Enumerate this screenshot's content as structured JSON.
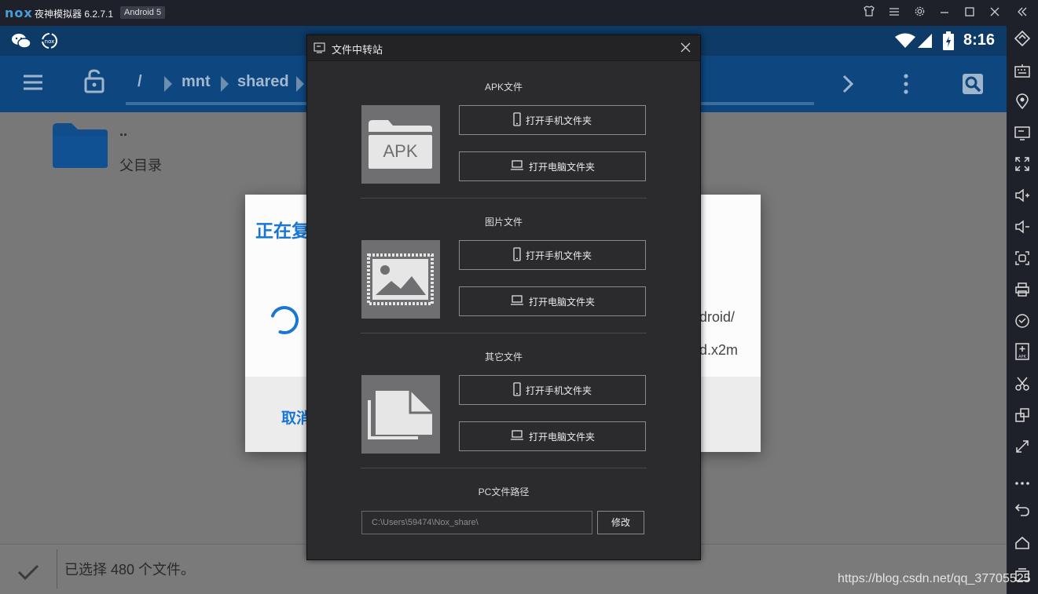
{
  "emulator": {
    "logo": "nox",
    "title": "夜神模拟器 6.2.7.1",
    "android_badge": "Android 5",
    "window_controls": [
      "shirt-icon",
      "menu-icon",
      "gear-icon",
      "minimize-icon",
      "maximize-icon",
      "close-icon",
      "collapse-icon"
    ],
    "toolbar_icons": [
      "rotate-icon",
      "keyboard-icon",
      "location-icon",
      "screen-icon",
      "fullscreen-icon",
      "volume-up-icon",
      "volume-down-icon",
      "screenshot-icon",
      "printer-icon",
      "sync-icon",
      "apk-install-icon",
      "scissors-icon",
      "multi-window-icon",
      "resize-icon",
      "more-icon",
      "back-icon",
      "home-icon",
      "recent-icon"
    ]
  },
  "android": {
    "status": {
      "time": "8:16"
    },
    "appbar": {
      "crumbs": [
        "/",
        "mnt",
        "shared"
      ]
    },
    "files": [
      {
        "name": "..",
        "label": "父目录"
      }
    ],
    "bottom": {
      "text": "已选择 480 个文件。"
    },
    "dialog": {
      "title": "正在复",
      "line1": "droid/",
      "line2": "d.x2m",
      "cancel": "取消"
    }
  },
  "transfer_dialog": {
    "title": "文件中转站",
    "sections": [
      {
        "title": "APK文件",
        "thumb_text": "APK",
        "phone_btn": "打开手机文件夹",
        "pc_btn": "打开电脑文件夹"
      },
      {
        "title": "图片文件",
        "phone_btn": "打开手机文件夹",
        "pc_btn": "打开电脑文件夹"
      },
      {
        "title": "其它文件",
        "phone_btn": "打开手机文件夹",
        "pc_btn": "打开电脑文件夹"
      }
    ],
    "pc_path_title": "PC文件路径",
    "pc_path_value": "C:\\Users\\59474\\Nox_share\\",
    "edit_button": "修改"
  },
  "watermark": "https://blog.csdn.net/qq_37705525",
  "colors": {
    "accent": "#1976d2",
    "titlebar": "#1e2129",
    "appbar": "#0e4780",
    "dialog_bg": "#2b2b2e"
  }
}
